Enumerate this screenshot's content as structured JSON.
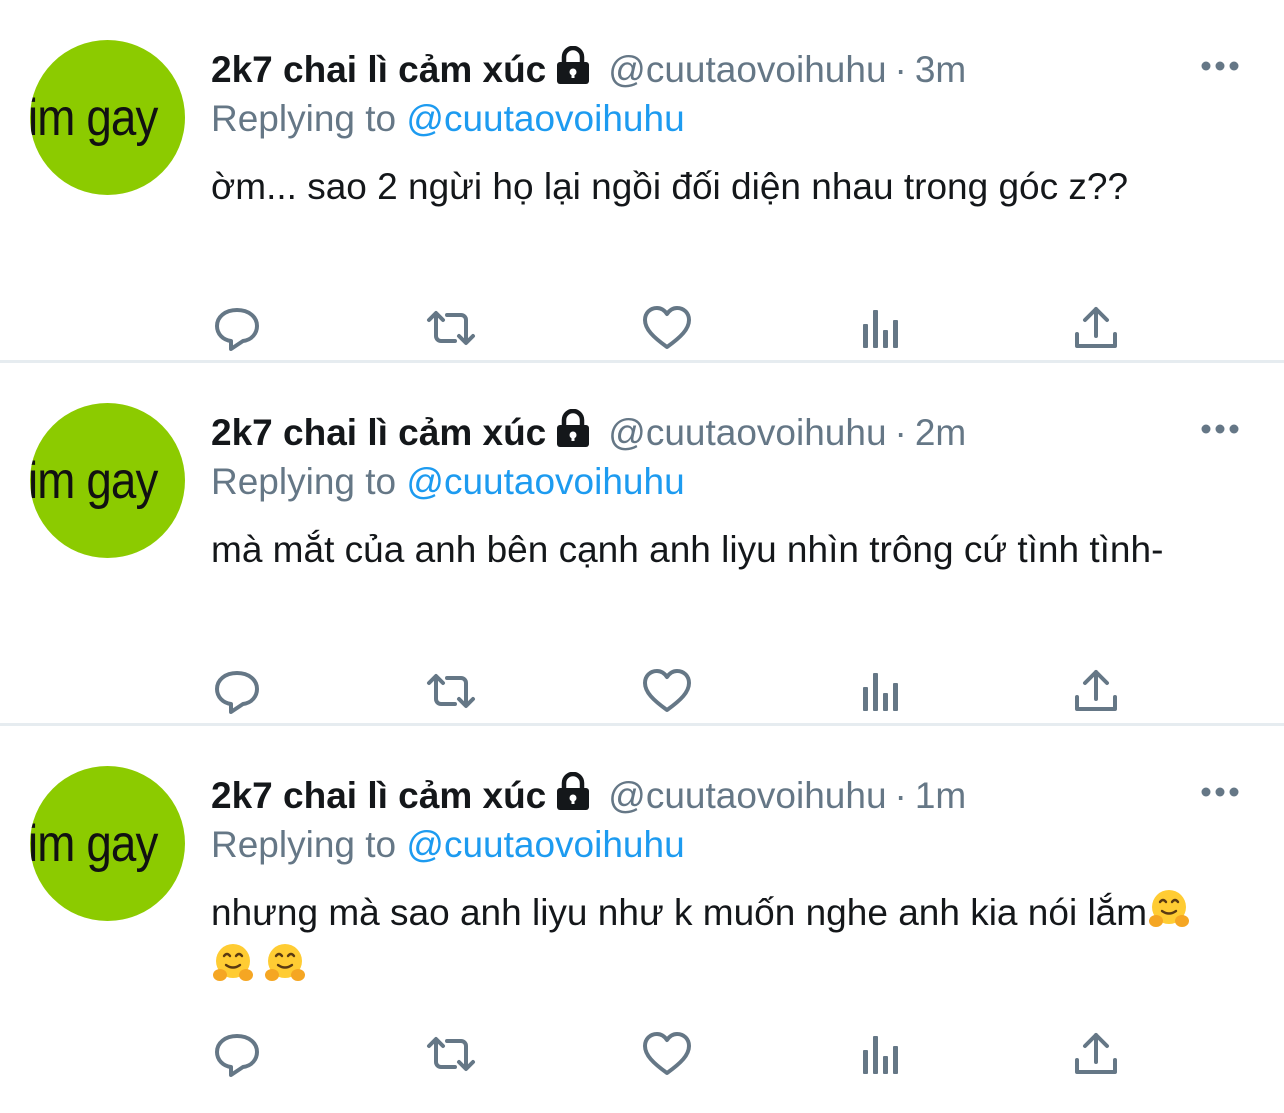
{
  "tweets": [
    {
      "avatar_text": "im gay",
      "display_name": "2k7 chai lì cảm xúc",
      "handle": "@cuutaovoihuhu",
      "separator": "·",
      "time": "3m",
      "replying_prefix": "Replying to",
      "replying_to": "@cuutaovoihuhu",
      "text": "ờm... sao 2 ngừi họ lại ngồi đối diện nhau trong góc z??",
      "emoji_count": 0
    },
    {
      "avatar_text": "im gay",
      "display_name": "2k7 chai lì cảm xúc",
      "handle": "@cuutaovoihuhu",
      "separator": "·",
      "time": "2m",
      "replying_prefix": "Replying to",
      "replying_to": "@cuutaovoihuhu",
      "text": "mà mắt của anh bên cạnh anh liyu nhìn trông cứ tình tình-",
      "emoji_count": 0
    },
    {
      "avatar_text": "im gay",
      "display_name": "2k7 chai lì cảm xúc",
      "handle": "@cuutaovoihuhu",
      "separator": "·",
      "time": "1m",
      "replying_prefix": "Replying to",
      "replying_to": "@cuutaovoihuhu",
      "text": "nhưng mà sao anh liyu như k muốn nghe anh kia nói lắm",
      "emoji_count": 3
    }
  ],
  "icons": {
    "lock": "lock-icon",
    "more": "more-horizontal-icon",
    "reply": "reply-icon",
    "retweet": "retweet-icon",
    "like": "heart-icon",
    "stats": "analytics-icon",
    "share": "share-icon",
    "emoji": "hugging-face-emoji"
  },
  "colors": {
    "link": "#1d9bf0",
    "secondary_text": "#657786",
    "avatar_bg": "#8ccb00",
    "divider": "#e6ecf0"
  }
}
